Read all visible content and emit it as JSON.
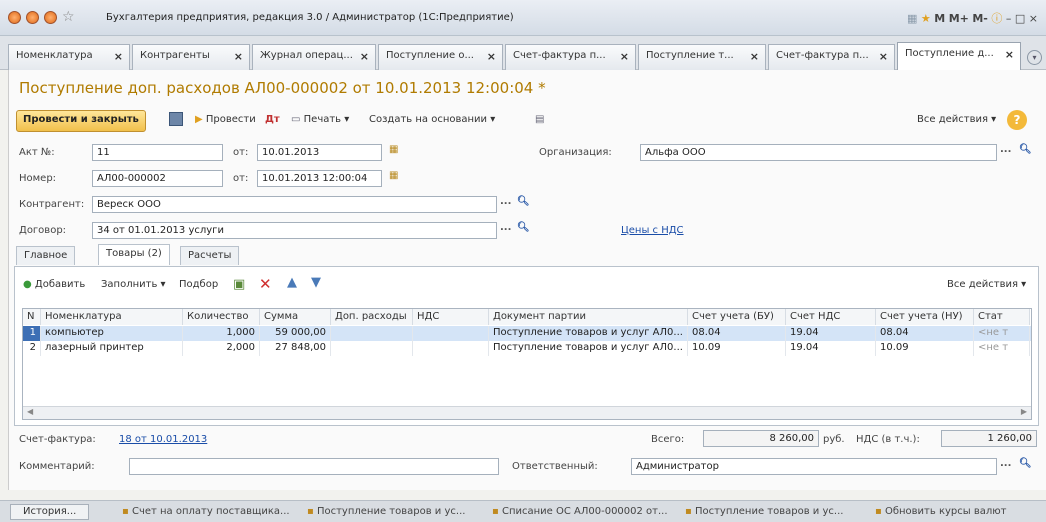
{
  "window": {
    "title": "Бухгалтерия предприятия, редакция 3.0 / Администратор (1С:Предприятие)"
  },
  "tabs": [
    {
      "label": "Номенклатура"
    },
    {
      "label": "Контрагенты"
    },
    {
      "label": "Журнал операц..."
    },
    {
      "label": "Поступление о..."
    },
    {
      "label": "Счет-фактура п..."
    },
    {
      "label": "Поступление т..."
    },
    {
      "label": "Счет-фактура п..."
    },
    {
      "label": "Поступление д..."
    }
  ],
  "document": {
    "title": "Поступление доп. расходов АЛ00-000002 от 10.01.2013 12:00:04 *"
  },
  "toolbar": {
    "post_close": "Провести и закрыть",
    "post": "Провести",
    "print": "Печать",
    "create_based": "Создать на основании",
    "all_actions": "Все действия"
  },
  "form": {
    "act_label": "Акт №:",
    "act_value": "11",
    "act_from_label": "от:",
    "act_date": "10.01.2013",
    "number_label": "Номер:",
    "number_value": "АЛ00-000002",
    "number_from_label": "от:",
    "number_date": "10.01.2013 12:00:04",
    "org_label": "Организация:",
    "org_value": "Альфа ООО",
    "counterparty_label": "Контрагент:",
    "counterparty_value": "Вереск ООО",
    "contract_label": "Договор:",
    "contract_value": "34 от 01.01.2013 услуги",
    "prices_link": "Цены с НДС"
  },
  "subtabs": [
    {
      "label": "Главное"
    },
    {
      "label": "Товары (2)"
    },
    {
      "label": "Расчеты"
    }
  ],
  "table_toolbar": {
    "add": "Добавить",
    "fill": "Заполнить",
    "select": "Подбор",
    "all_actions": "Все действия"
  },
  "table": {
    "headers": [
      "N",
      "Номенклатура",
      "Количество",
      "Сумма",
      "Доп. расходы",
      "НДС",
      "Документ партии",
      "Счет учета (БУ)",
      "Счет НДС",
      "Счет учета (НУ)",
      "Стат"
    ],
    "rows": [
      [
        "1",
        "компьютер",
        "1,000",
        "59 000,00",
        "",
        "",
        "Поступление товаров и услуг АЛ0...",
        "08.04",
        "19.04",
        "08.04",
        "<не т"
      ],
      [
        "2",
        "лазерный принтер",
        "2,000",
        "27 848,00",
        "",
        "",
        "Поступление товаров и услуг АЛ0...",
        "10.09",
        "19.04",
        "10.09",
        "<не т"
      ]
    ]
  },
  "footer": {
    "invoice_label": "Счет-фактура:",
    "invoice_link": "18 от 10.01.2013",
    "total_label": "Всего:",
    "total_value": "8 260,00",
    "currency": "руб.",
    "vat_label": "НДС (в т.ч.):",
    "vat_value": "1 260,00",
    "comment_label": "Комментарий:",
    "comment_value": "",
    "responsible_label": "Ответственный:",
    "responsible_value": "Администратор"
  },
  "taskbar": {
    "history": "История...",
    "items": [
      "Счет на оплату поставщика...",
      "Поступление товаров и ус...",
      "Списание ОС АЛ00-000002 от...",
      "Поступление товаров и ус...",
      "Обновить курсы валют"
    ]
  }
}
